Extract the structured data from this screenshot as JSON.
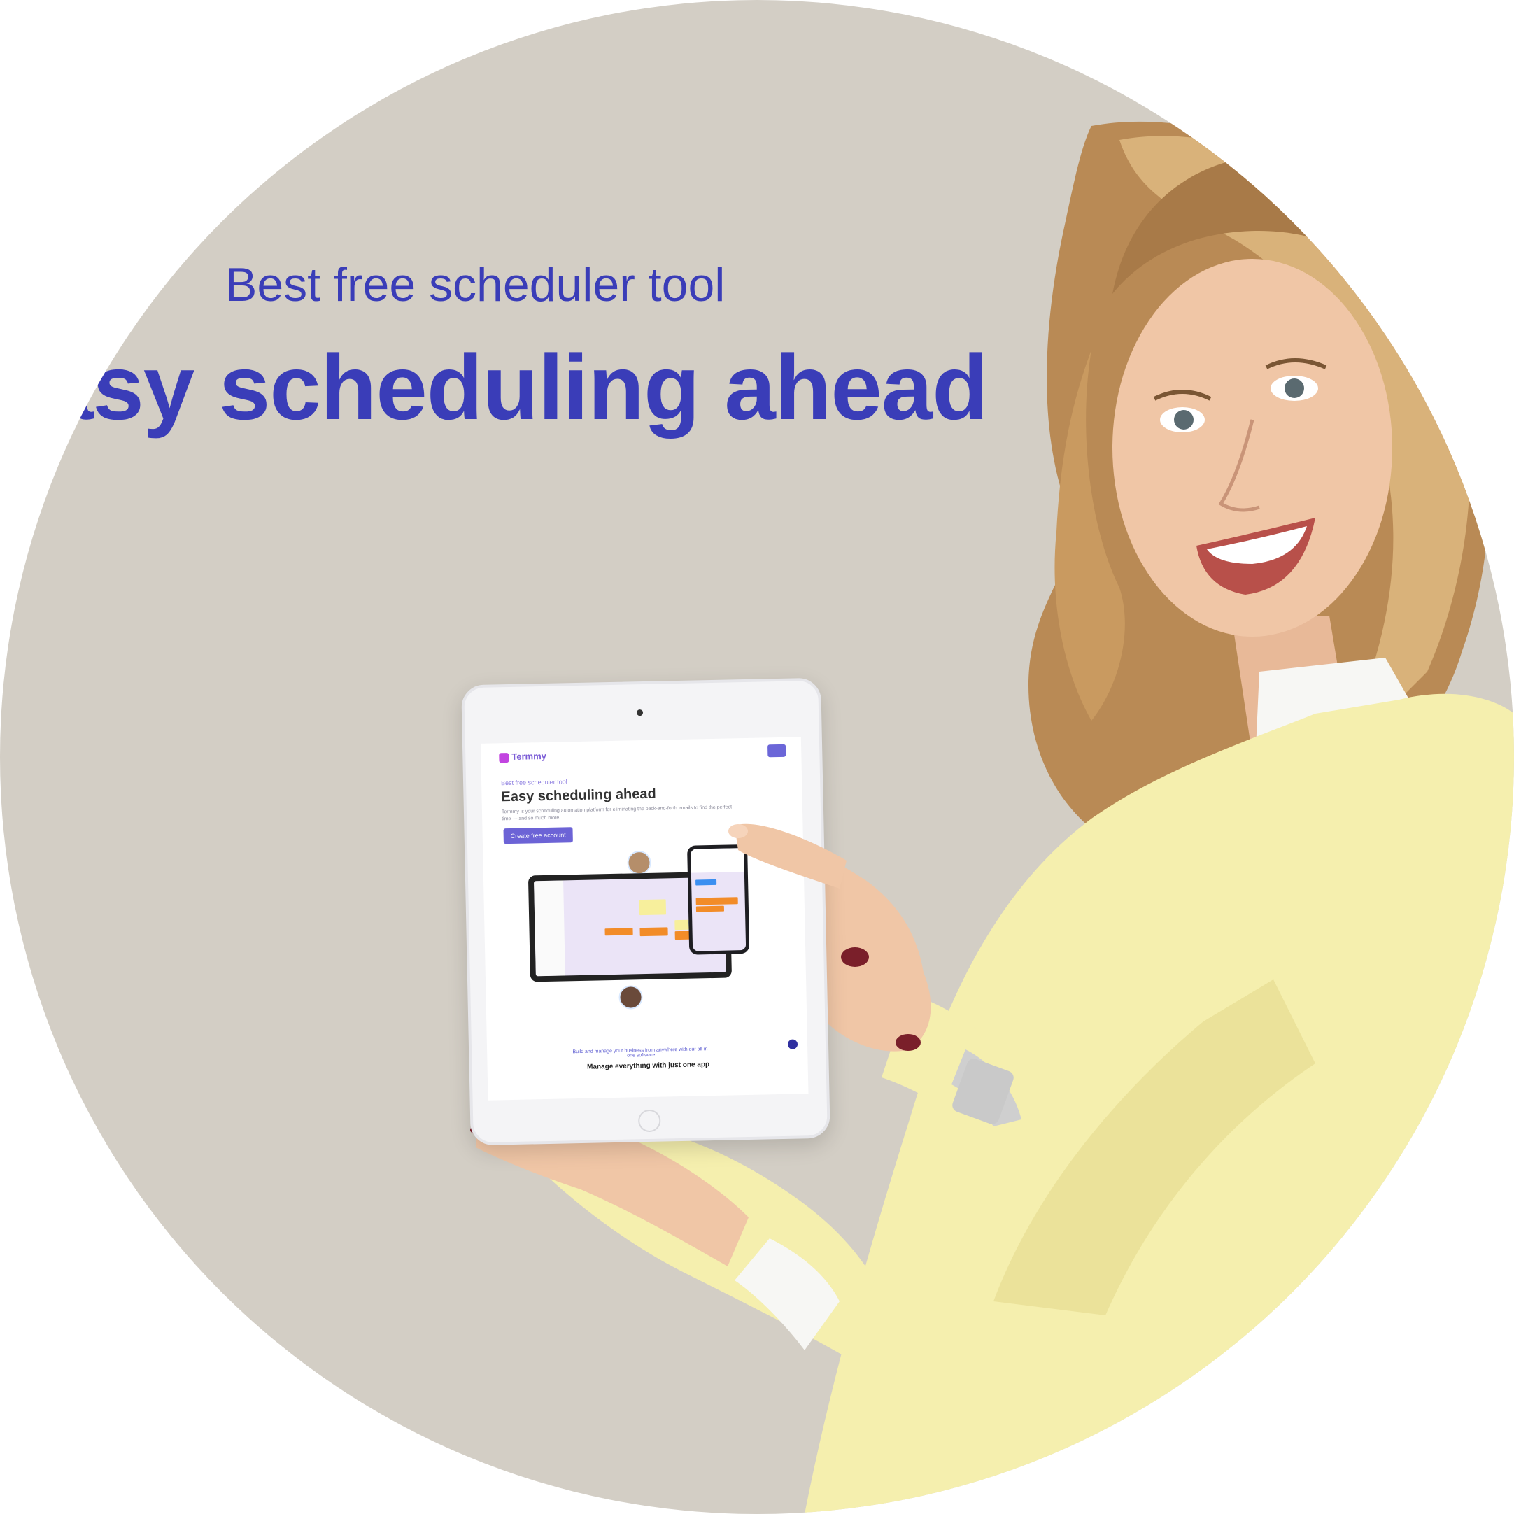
{
  "hero": {
    "tagline": "Best free scheduler tool",
    "headline": "asy scheduling ahead"
  },
  "tablet_screen": {
    "brand": "Termmy",
    "subtitle": "Best free scheduler tool",
    "title": "Easy scheduling ahead",
    "description": "Termmy is your scheduling automation platform for eliminating the back-and-forth emails to find the perfect time — and so much more.",
    "cta_label": "Create free account",
    "manage_subtitle": "Build and manage your business from anywhere with our all-in-one software",
    "manage_title": "Manage everything with just one app"
  },
  "colors": {
    "accent": "#3a3db8",
    "background": "#d3cec5",
    "jacket": "#f5efae",
    "cta": "#6c63d6"
  }
}
